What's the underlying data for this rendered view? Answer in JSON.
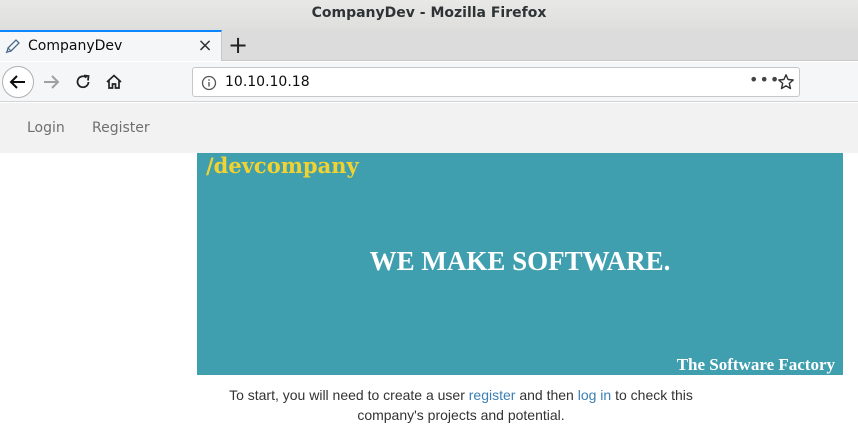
{
  "window": {
    "title": "CompanyDev - Mozilla Firefox"
  },
  "tab": {
    "label": "CompanyDev",
    "close": "×"
  },
  "newtab": {
    "label": "+"
  },
  "urlbar": {
    "url": "10.10.10.18",
    "more": "•••"
  },
  "sitenav": {
    "login": "Login",
    "register": "Register"
  },
  "hero": {
    "brand": "/devcompany",
    "headline": "WE MAKE SOFTWARE.",
    "tagline": "The Software Factory"
  },
  "intro": {
    "before": "To start, you will need to create a user ",
    "register_link": "register",
    "middle": " and then ",
    "login_link": "log in",
    "after": " to check this company's projects and potential."
  },
  "colors": {
    "hero_bg": "#3f9faf",
    "brand": "#f2d230",
    "link": "#3a7fb5",
    "tab_accent": "#0a84ff"
  }
}
